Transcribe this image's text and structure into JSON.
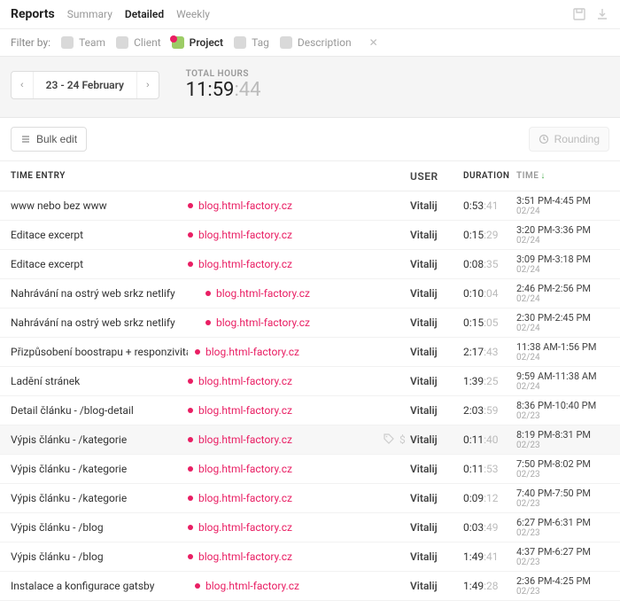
{
  "header": {
    "title": "Reports",
    "tabs": [
      {
        "label": "Summary",
        "active": false
      },
      {
        "label": "Detailed",
        "active": true
      },
      {
        "label": "Weekly",
        "active": false
      }
    ]
  },
  "filter": {
    "label": "Filter by:",
    "items": [
      {
        "key": "team",
        "label": "Team"
      },
      {
        "key": "client",
        "label": "Client"
      },
      {
        "key": "project",
        "label": "Project",
        "active": true,
        "hasBadge": true
      },
      {
        "key": "tag",
        "label": "Tag"
      },
      {
        "key": "description",
        "label": "Description"
      }
    ]
  },
  "range": {
    "label": "23 - 24 February"
  },
  "total": {
    "label": "TOTAL HOURS",
    "hhmm": "11:59",
    "ss": ":44"
  },
  "toolbar": {
    "bulk": "Bulk edit",
    "rounding": "Rounding"
  },
  "columns": {
    "entry": "TIME ENTRY",
    "user": "USER",
    "duration": "DURATION",
    "time": "TIME"
  },
  "entries": [
    {
      "desc": "www nebo bez www",
      "project": "blog.html-factory.cz",
      "pad": 0,
      "user": "Vitalij",
      "dur": "0:53",
      "dursec": ":41",
      "range": "3:51 PM-4:45 PM",
      "date": "02/24"
    },
    {
      "desc": "Editace excerpt",
      "project": "blog.html-factory.cz",
      "pad": 0,
      "user": "Vitalij",
      "dur": "0:15",
      "dursec": ":29",
      "range": "3:20 PM-3:36 PM",
      "date": "02/24"
    },
    {
      "desc": "Editace excerpt",
      "project": "blog.html-factory.cz",
      "pad": 0,
      "user": "Vitalij",
      "dur": "0:08",
      "dursec": ":35",
      "range": "3:09 PM-3:18 PM",
      "date": "02/24"
    },
    {
      "desc": "Nahrávání na ostrý web srkz netlify",
      "project": "blog.html-factory.cz",
      "pad": 1,
      "user": "Vitalij",
      "dur": "0:10",
      "dursec": ":04",
      "range": "2:46 PM-2:56 PM",
      "date": "02/24"
    },
    {
      "desc": "Nahrávání na ostrý web srkz netlify",
      "project": "blog.html-factory.cz",
      "pad": 1,
      "user": "Vitalij",
      "dur": "0:15",
      "dursec": ":05",
      "range": "2:30 PM-2:45 PM",
      "date": "02/24"
    },
    {
      "desc": "Přizpůsobení boostrapu + responzivita",
      "project": "blog.html-factory.cz",
      "pad": 2,
      "user": "Vitalij",
      "dur": "2:17",
      "dursec": ":43",
      "range": "11:38 AM-1:56 PM",
      "date": "02/24"
    },
    {
      "desc": "Ladění stránek",
      "project": "blog.html-factory.cz",
      "pad": 0,
      "user": "Vitalij",
      "dur": "1:39",
      "dursec": ":25",
      "range": "9:59 AM-11:38 AM",
      "date": "02/24"
    },
    {
      "desc": "Detail článku - /blog-detail",
      "project": "blog.html-factory.cz",
      "pad": 0,
      "user": "Vitalij",
      "dur": "2:03",
      "dursec": ":59",
      "range": "8:36 PM-10:40 PM",
      "date": "02/23"
    },
    {
      "desc": "Výpis článku - /kategorie",
      "project": "blog.html-factory.cz",
      "pad": 0,
      "user": "Vitalij",
      "dur": "0:11",
      "dursec": ":40",
      "range": "8:19 PM-8:31 PM",
      "date": "02/23",
      "hovered": true
    },
    {
      "desc": "Výpis článku - /kategorie",
      "project": "blog.html-factory.cz",
      "pad": 0,
      "user": "Vitalij",
      "dur": "0:11",
      "dursec": ":53",
      "range": "7:50 PM-8:02 PM",
      "date": "02/23"
    },
    {
      "desc": "Výpis článku - /kategorie",
      "project": "blog.html-factory.cz",
      "pad": 0,
      "user": "Vitalij",
      "dur": "0:09",
      "dursec": ":12",
      "range": "7:40 PM-7:50 PM",
      "date": "02/23"
    },
    {
      "desc": "Výpis článku - /blog",
      "project": "blog.html-factory.cz",
      "pad": 0,
      "user": "Vitalij",
      "dur": "0:03",
      "dursec": ":49",
      "range": "6:27 PM-6:31 PM",
      "date": "02/23"
    },
    {
      "desc": "Výpis článku - /blog",
      "project": "blog.html-factory.cz",
      "pad": 0,
      "user": "Vitalij",
      "dur": "1:49",
      "dursec": ":41",
      "range": "4:37 PM-6:27 PM",
      "date": "02/23"
    },
    {
      "desc": "Instalace a konfigurace gatsby",
      "project": "blog.html-factory.cz",
      "pad": 2,
      "user": "Vitalij",
      "dur": "1:49",
      "dursec": ":28",
      "range": "2:36 PM-4:25 PM",
      "date": "02/23"
    }
  ]
}
